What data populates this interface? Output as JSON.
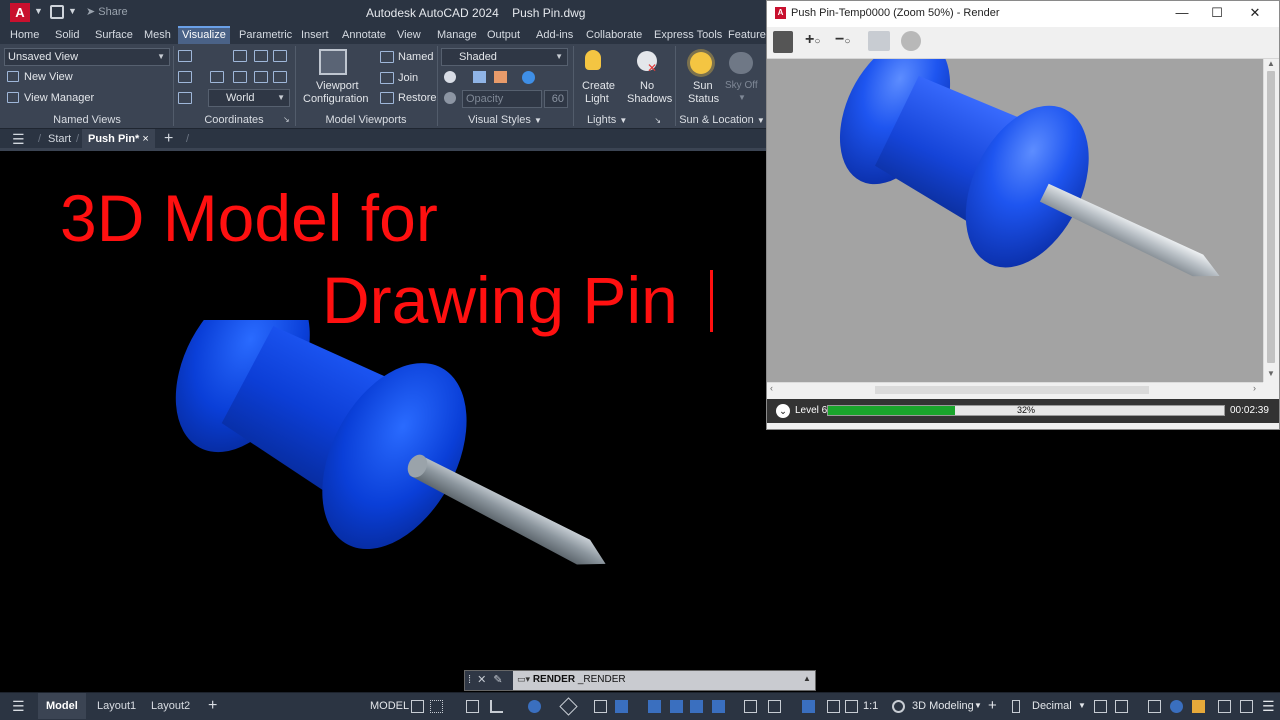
{
  "titlebar": {
    "app_logo": "A",
    "share_label": "Share",
    "window_title": "Autodesk AutoCAD 2024    Push Pin.dwg"
  },
  "ribbon_tabs": [
    "Home",
    "Solid",
    "Surface",
    "Mesh",
    "Visualize",
    "Parametric",
    "Insert",
    "Annotate",
    "View",
    "Manage",
    "Output",
    "Add-ins",
    "Collaborate",
    "Express Tools",
    "Featured"
  ],
  "active_ribbon_tab": "Visualize",
  "ribbon": {
    "named_views": {
      "view_dropdown": "Unsaved View",
      "new_view": "New View",
      "view_manager": "View Manager",
      "label": "Named Views"
    },
    "coordinates": {
      "ucs_dropdown": "World",
      "label": "Coordinates"
    },
    "model_viewports": {
      "viewport_config_line1": "Viewport",
      "viewport_config_line2": "Configuration",
      "named": "Named",
      "join": "Join",
      "restore": "Restore",
      "label": "Model Viewports"
    },
    "visual_styles": {
      "style_dropdown": "Shaded",
      "opacity_placeholder": "Opacity",
      "opacity_value": "60",
      "label": "Visual Styles"
    },
    "lights": {
      "create_light_line1": "Create",
      "create_light_line2": "Light",
      "no_shadows_line1": "No",
      "no_shadows_line2": "Shadows",
      "label": "Lights"
    },
    "sun_location": {
      "sun_status_line1": "Sun",
      "sun_status_line2": "Status",
      "sky_off": "Sky Off",
      "label": "Sun & Location"
    }
  },
  "file_tabs": {
    "start": "Start",
    "active": "Push Pin*",
    "close": "×",
    "add": "+"
  },
  "canvas": {
    "line1": "3D Model for",
    "line2": "Drawing Pin"
  },
  "render_window": {
    "title": "Push Pin-Temp0000 (Zoom 50%) - Render",
    "status_level": "Level 6",
    "progress_percent": 32,
    "progress_label": "32%",
    "elapsed_time": "00:02:39"
  },
  "command_line": {
    "command": "RENDER",
    "echo": "_RENDER"
  },
  "statusbar": {
    "layouts": [
      "Model",
      "Layout1",
      "Layout2"
    ],
    "add": "+",
    "model_label": "MODEL",
    "scale": "1:1",
    "workspace": "3D Modeling",
    "units": "Decimal"
  }
}
